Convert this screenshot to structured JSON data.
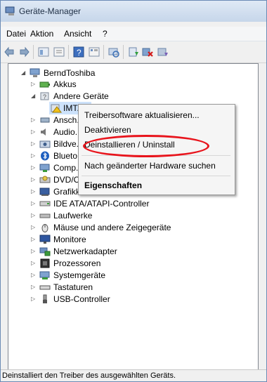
{
  "window": {
    "title": "Geräte-Manager"
  },
  "menu": {
    "items": [
      "Datei",
      "Aktion",
      "Ansicht",
      "?"
    ]
  },
  "toolbar": {
    "icons": [
      "back-icon",
      "forward-icon",
      "properties-view-icon",
      "list-view-icon",
      "help-icon",
      "details-view-icon",
      "scan-hardware-icon",
      "update-driver-icon",
      "uninstall-icon",
      "disable-icon"
    ]
  },
  "tree": {
    "root": "BerndToshiba",
    "items": [
      {
        "label": "Akkus",
        "icon": "battery-icon",
        "level": 1
      },
      {
        "label": "Andere Geräte",
        "icon": "unknown-device-icon",
        "level": 1,
        "expanded": true
      },
      {
        "label": "IMT...",
        "icon": "warning-device-icon",
        "level": 2,
        "selected": true
      },
      {
        "label": "Ansch...",
        "icon": "port-icon",
        "level": 1
      },
      {
        "label": "Audio...",
        "icon": "audio-icon",
        "level": 1
      },
      {
        "label": "Bildve...",
        "icon": "imaging-icon",
        "level": 1
      },
      {
        "label": "Blueto...",
        "icon": "bluetooth-icon",
        "level": 1
      },
      {
        "label": "Comp...",
        "icon": "computer-icon",
        "level": 1
      },
      {
        "label": "DVD/C...",
        "icon": "dvd-icon",
        "level": 1
      },
      {
        "label": "Grafikkarte",
        "icon": "display-adapter-icon",
        "level": 1
      },
      {
        "label": "IDE ATA/ATAPI-Controller",
        "icon": "ide-controller-icon",
        "level": 1
      },
      {
        "label": "Laufwerke",
        "icon": "disk-drive-icon",
        "level": 1
      },
      {
        "label": "Mäuse und andere Zeigegeräte",
        "icon": "mouse-icon",
        "level": 1
      },
      {
        "label": "Monitore",
        "icon": "monitor-icon",
        "level": 1
      },
      {
        "label": "Netzwerkadapter",
        "icon": "network-adapter-icon",
        "level": 1
      },
      {
        "label": "Prozessoren",
        "icon": "processor-icon",
        "level": 1
      },
      {
        "label": "Systemgeräte",
        "icon": "system-device-icon",
        "level": 1
      },
      {
        "label": "Tastaturen",
        "icon": "keyboard-icon",
        "level": 1
      },
      {
        "label": "USB-Controller",
        "icon": "usb-icon",
        "level": 1
      }
    ]
  },
  "context_menu": {
    "items": [
      {
        "label": "Treibersoftware aktualisieren...",
        "bold": false
      },
      {
        "label": "Deaktivieren",
        "bold": false
      },
      {
        "label": "Deinstallieren / Uninstall",
        "bold": false,
        "highlighted": true
      },
      {
        "label": "Nach geänderter Hardware suchen",
        "bold": false
      },
      {
        "label": "Eigenschaften",
        "bold": true
      }
    ]
  },
  "status": {
    "text": "Deinstalliert den Treiber des ausgewählten Geräts."
  },
  "colors": {
    "highlight_ring": "#e8141c",
    "title_gradient_top": "#dfe9f5",
    "title_gradient_bottom": "#c6d6ea"
  }
}
